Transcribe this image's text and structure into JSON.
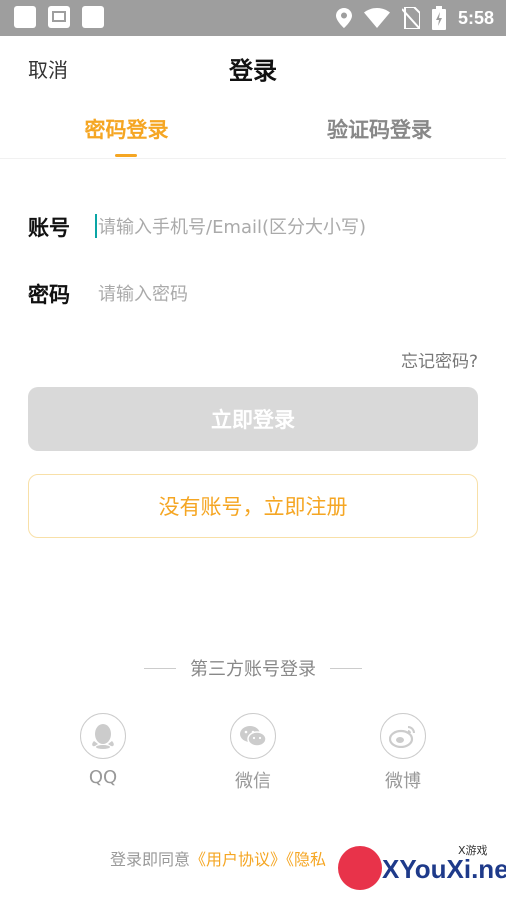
{
  "status_bar": {
    "time": "5:58",
    "icons": [
      "notification-box-icon",
      "image-icon",
      "notification-box-icon",
      "location-icon",
      "wifi-icon",
      "no-sim-icon",
      "battery-charging-icon"
    ]
  },
  "header": {
    "cancel_label": "取消",
    "title": "登录"
  },
  "tabs": [
    {
      "label": "密码登录",
      "active": true
    },
    {
      "label": "验证码登录",
      "active": false
    }
  ],
  "account_field": {
    "label": "账号",
    "placeholder": "请输入手机号/Email(区分大小写)",
    "value": ""
  },
  "password_field": {
    "label": "密码",
    "placeholder": "请输入密码",
    "value": ""
  },
  "forgot_password": "忘记密码?",
  "login_button": "立即登录",
  "register_button": "没有账号，立即注册",
  "third_party": {
    "title": "第三方账号登录",
    "options": [
      {
        "label": "QQ",
        "icon": "qq-icon"
      },
      {
        "label": "微信",
        "icon": "wechat-icon"
      },
      {
        "label": "微博",
        "icon": "weibo-icon"
      }
    ]
  },
  "agreement": {
    "prefix": "登录即同意",
    "user_agreement": "《用户协议》",
    "privacy": "《隐私"
  },
  "watermark": {
    "text": "XYouXi.net",
    "small": "X游戏"
  },
  "colors": {
    "accent": "#f5a623",
    "status_bar": "#9e9e9e",
    "disabled_button": "#d9d9d9"
  }
}
